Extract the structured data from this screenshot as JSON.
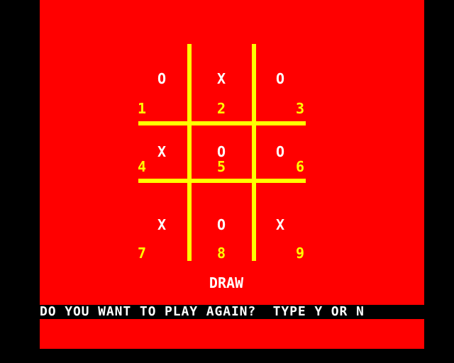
{
  "colors": {
    "background": "#ff0000",
    "border": "#000000",
    "grid": "#ffff00",
    "marks": "#ffffff",
    "numbers": "#ffff00",
    "prompt_bg": "#000000",
    "prompt_fg": "#ffffff"
  },
  "board": {
    "cells": [
      {
        "mark": "O",
        "number": "1"
      },
      {
        "mark": "X",
        "number": "2"
      },
      {
        "mark": "O",
        "number": "3"
      },
      {
        "mark": "X",
        "number": "4"
      },
      {
        "mark": "O",
        "number": "5"
      },
      {
        "mark": "O",
        "number": "6"
      },
      {
        "mark": "X",
        "number": "7"
      },
      {
        "mark": "O",
        "number": "8"
      },
      {
        "mark": "X",
        "number": "9"
      }
    ]
  },
  "status": "DRAW",
  "prompt": "DO YOU WANT TO PLAY AGAIN?  TYPE Y OR N"
}
